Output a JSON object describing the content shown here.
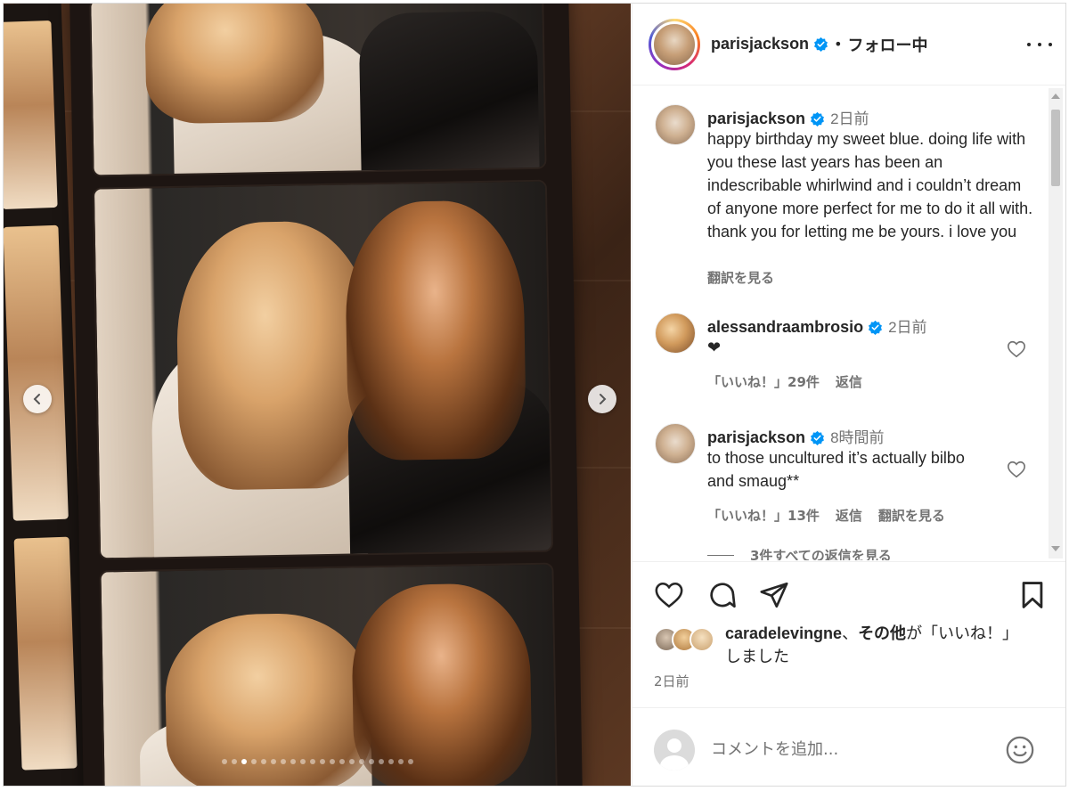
{
  "post": {
    "username": "parisjackson",
    "separator": "•",
    "follow_status": "フォロー中",
    "more_label": "..."
  },
  "photo": {
    "carousel_total": 20,
    "carousel_active": 2
  },
  "caption": {
    "username": "parisjackson",
    "time": "2日前",
    "text": "happy birthday my sweet blue. doing life with you these last years has been an indescribable whirlwind and i couldn’t dream of anyone more perfect for me to do it all with. thank you for letting me be yours. i love you",
    "translate": "翻訳を見る"
  },
  "comments": [
    {
      "username": "alessandraambrosio",
      "time": "2日前",
      "text": "❤",
      "likes": "「いいね！」29件",
      "reply": "返信"
    },
    {
      "username": "parisjackson",
      "time": "8時間前",
      "text": "to those uncultured it’s actually bilbo and smaug**",
      "likes": "「いいね！」13件",
      "reply": "返信",
      "translate": "翻訳を見る",
      "view_replies": "3件すべての返信を見る"
    }
  ],
  "likes": {
    "liker": "caradelevingne",
    "joiner": "、",
    "others": "その他",
    "suffix": "が「いいね！」しました"
  },
  "post_date": "2日前",
  "comment_box": {
    "placeholder": "コメントを追加..."
  },
  "colors": {
    "verified": "#0095f6",
    "text": "#262626",
    "secondary": "#737373"
  },
  "icons": [
    "verified-icon",
    "more-icon",
    "heart-icon",
    "comment-icon",
    "share-icon",
    "bookmark-icon",
    "emoji-icon",
    "chevron-left-icon",
    "chevron-right-icon"
  ]
}
